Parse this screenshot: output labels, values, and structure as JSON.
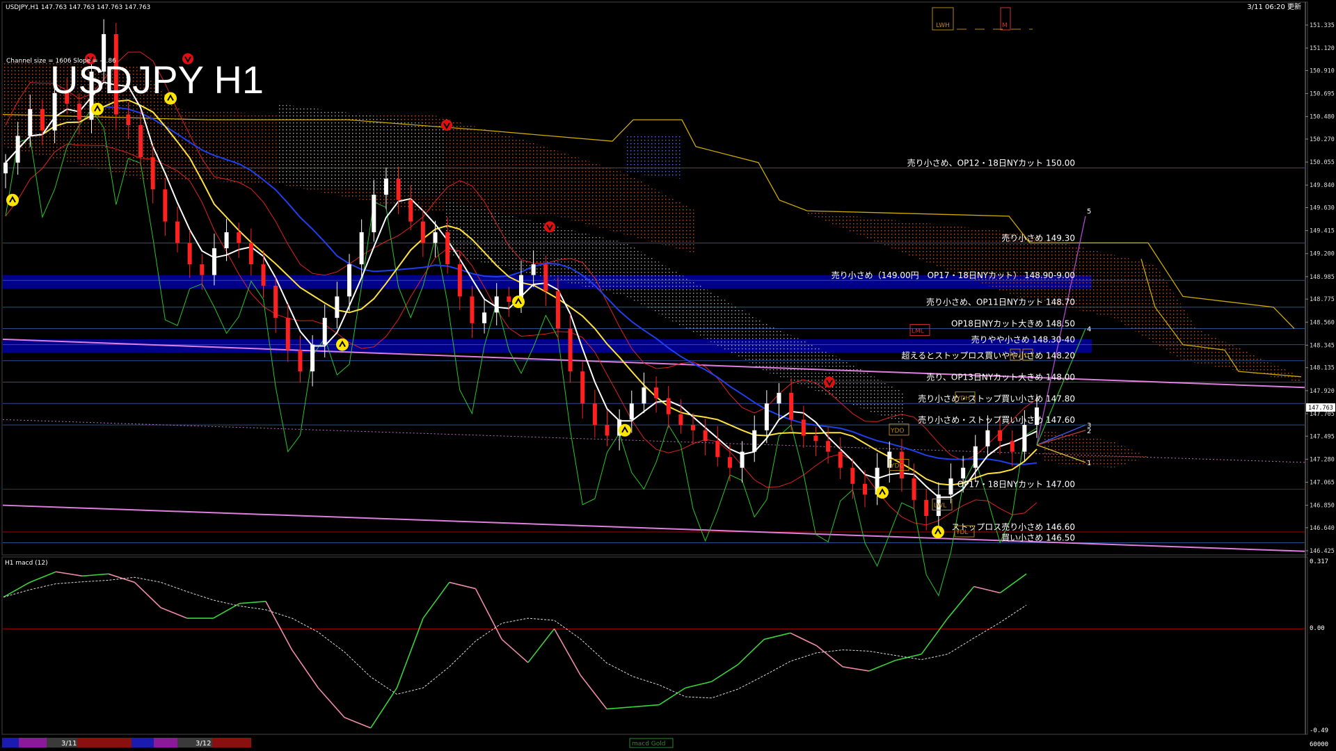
{
  "header": {
    "symbol_line": "USDJPY,H1  147.763 147.763 147.763 147.763",
    "update_time": "3/11 06:20 更新",
    "big_title": "USDJPY H1",
    "channel_info": "Channel size = 1606 Slope = -1.86",
    "badges": [
      "LWH",
      "M"
    ]
  },
  "macd_panel": {
    "label": "H1 macd (12)",
    "scale_top": "0.317",
    "scale_zero": "0.00",
    "scale_bottom": "-0.49",
    "bottom_value": "60000"
  },
  "bottom_bar": {
    "dates": [
      "3/11",
      "3/12"
    ],
    "center_tab": "macd Gold"
  },
  "colors": {
    "background": "#000000",
    "bull_candle": "#ffffff",
    "bear_candle": "#ff2020",
    "ma_fast": "#ffffff",
    "ma_mid": "#ffe23a",
    "ma_slow": "#1f3ff0",
    "bollinger": "#e02020",
    "stoch_green": "#28c828",
    "channel_pink": "#e07de0",
    "cloud_red": "#b44400",
    "cloud_yellow": "#ccaa00",
    "grid_blue": "#2a4f8f",
    "macd_up": "#3ad43a",
    "macd_down": "#f08aa8",
    "zero_line": "#b00000",
    "zone_blue": "#00008a",
    "label_box_gold": "#b8860b"
  },
  "chart_data": {
    "type": "line",
    "title": "USDJPY H1",
    "symbol": "USDJPY",
    "timeframe": "H1",
    "last_price": 147.763,
    "y_ticks": [
      151.335,
      151.12,
      150.91,
      150.695,
      150.48,
      150.27,
      150.055,
      149.84,
      149.63,
      149.415,
      149.2,
      148.985,
      148.775,
      148.56,
      148.345,
      148.135,
      147.92,
      147.705,
      147.495,
      147.28,
      147.065,
      146.85,
      146.64,
      146.425
    ],
    "y_range": [
      146.4,
      151.5
    ],
    "x_labels": [
      "3/11",
      "3/12"
    ],
    "close_series": [
      150.05,
      150.3,
      150.55,
      150.35,
      150.7,
      150.6,
      150.45,
      150.9,
      151.25,
      150.5,
      150.4,
      150.1,
      149.8,
      149.5,
      149.3,
      149.1,
      149.0,
      149.25,
      149.4,
      149.3,
      149.1,
      148.9,
      148.6,
      148.3,
      148.1,
      148.35,
      148.6,
      148.8,
      149.1,
      149.4,
      149.75,
      149.9,
      149.7,
      149.5,
      149.3,
      149.4,
      149.1,
      148.8,
      148.55,
      148.65,
      148.8,
      148.75,
      149.0,
      149.1,
      148.85,
      148.5,
      148.1,
      147.8,
      147.6,
      147.5,
      147.65,
      147.8,
      147.95,
      147.85,
      147.7,
      147.6,
      147.55,
      147.45,
      147.3,
      147.2,
      147.35,
      147.55,
      147.8,
      147.9,
      147.65,
      147.5,
      147.45,
      147.35,
      147.2,
      147.05,
      146.95,
      147.2,
      147.35,
      147.1,
      146.9,
      146.75,
      146.95,
      147.1,
      147.2,
      147.4,
      147.55,
      147.45,
      147.35,
      147.6,
      147.763
    ],
    "levels": [
      {
        "price": 150.0,
        "label": "売り小さめ、OP12・18日NYカット 150.00"
      },
      {
        "price": 149.3,
        "label": "売り小さめ 149.30"
      },
      {
        "price": 148.95,
        "label": "売り小さめ（149.00円　OP17・18日NYカット） 148.90-9.00"
      },
      {
        "price": 148.7,
        "label": "売り小さめ、OP11日NYカット 148.70"
      },
      {
        "price": 148.5,
        "label": "OP18日NYカット大きめ 148.50"
      },
      {
        "price": 148.35,
        "label": "売りやや小さめ 148.30-40"
      },
      {
        "price": 148.2,
        "label": "超えるとストップロス買いやや小さめ 148.20"
      },
      {
        "price": 148.0,
        "label": "売り、OP13日NYカット大きめ 148.00"
      },
      {
        "price": 147.8,
        "label": "売り小さめ・ストップ買い小さめ 147.80"
      },
      {
        "price": 147.6,
        "label": "売り小さめ・ストップ買い小さめ 147.60"
      },
      {
        "price": 147.0,
        "label": "OP17・18日NYカット 147.00"
      },
      {
        "price": 146.6,
        "label": "ストップロス売り小さめ 146.60"
      },
      {
        "price": 146.5,
        "label": "買い小さめ 146.50"
      }
    ],
    "markers": [
      "LML",
      "YDH",
      "YDO",
      "YDC",
      "LWL",
      "YDL",
      "W",
      "D"
    ],
    "projection_labels": [
      "5",
      "4",
      "3",
      "2",
      "1"
    ],
    "macd_series": [
      0.15,
      0.22,
      0.27,
      0.25,
      0.26,
      0.22,
      0.1,
      0.05,
      0.05,
      0.12,
      0.13,
      -0.1,
      -0.28,
      -0.42,
      -0.47,
      -0.28,
      0.05,
      0.22,
      0.19,
      -0.05,
      -0.16,
      0.0,
      -0.22,
      -0.38,
      -0.37,
      -0.36,
      -0.28,
      -0.25,
      -0.17,
      -0.05,
      -0.02,
      -0.08,
      -0.18,
      -0.2,
      -0.15,
      -0.12,
      0.05,
      0.2,
      0.17,
      0.26
    ],
    "macd_range": [
      -0.49,
      0.317
    ]
  }
}
